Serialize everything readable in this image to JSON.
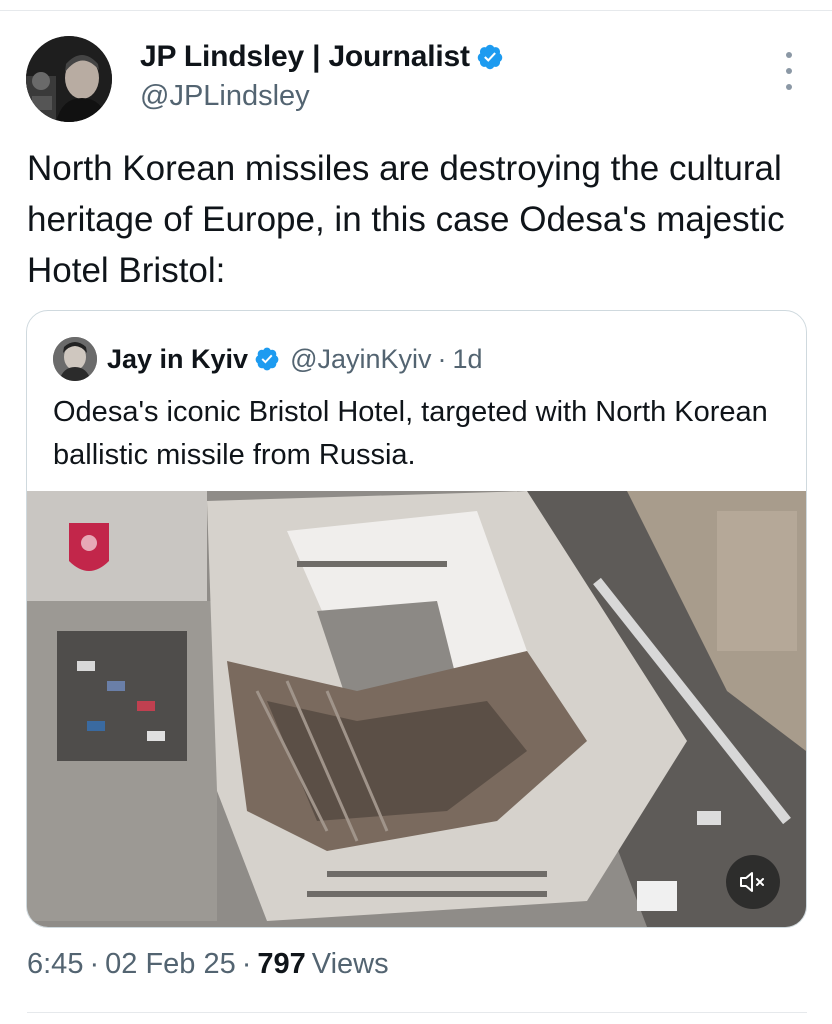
{
  "author": {
    "name": "JP Lindsley | Journalist",
    "handle": "@JPLindsley"
  },
  "tweet_text": "North Korean missiles are destroying the cultural heritage of Europe, in this case Odesa's majestic Hotel Bristol:",
  "quoted": {
    "name": "Jay in Kyiv",
    "handle": "@JayinKyiv",
    "separator": "·",
    "age": "1d",
    "text": "Odesa's iconic Bristol Hotel, targeted with North Korean ballistic missile from Russia."
  },
  "meta": {
    "time": "6:45",
    "date": "02 Feb 25",
    "views_count": "797",
    "views_label": "Views",
    "sep": "·"
  },
  "colors": {
    "verified": "#1d9bf0",
    "secondary_text": "#536471",
    "border": "#cfd9de"
  },
  "icons": [
    "verified-badge-icon",
    "more-options-icon",
    "mute-icon"
  ]
}
